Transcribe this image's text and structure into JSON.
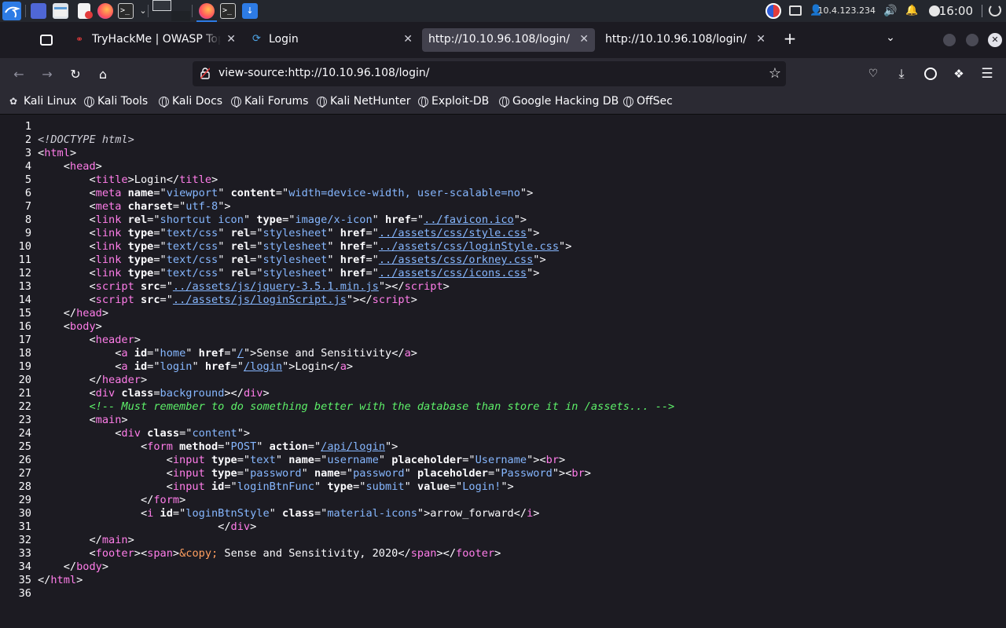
{
  "taskbar": {
    "ip": "10.4.123.234",
    "clock": "16:00"
  },
  "tabs": [
    {
      "label": "TryHackMe | OWASP Top",
      "icon": "tryhackme-icon"
    },
    {
      "label": "Login",
      "icon": "vscode-icon"
    },
    {
      "label": "http://10.10.96.108/login/",
      "icon": ""
    },
    {
      "label": "http://10.10.96.108/login/",
      "icon": ""
    }
  ],
  "address": {
    "url": "view-source:http://10.10.96.108/login/"
  },
  "bookmarks": [
    "Kali Linux",
    "Kali Tools",
    "Kali Docs",
    "Kali Forums",
    "Kali NetHunter",
    "Exploit-DB",
    "Google Hacking DB",
    "OffSec"
  ],
  "source_lines": [
    [],
    [
      [
        "dt",
        "<!DOCTYPE html>"
      ]
    ],
    [
      [
        "tx",
        "<"
      ],
      [
        "tg",
        "html"
      ],
      [
        "tx",
        ">"
      ]
    ],
    [
      [
        "tx",
        "    <"
      ],
      [
        "tg",
        "head"
      ],
      [
        "tx",
        ">"
      ]
    ],
    [
      [
        "tx",
        "        <"
      ],
      [
        "tg",
        "title"
      ],
      [
        "tx",
        ">Login</"
      ],
      [
        "tg",
        "title"
      ],
      [
        "tx",
        ">"
      ]
    ],
    [
      [
        "tx",
        "        <"
      ],
      [
        "tg",
        "meta "
      ],
      [
        "at",
        "name"
      ],
      [
        "tx",
        "=\""
      ],
      [
        "av",
        "viewport"
      ],
      [
        "tx",
        "\" "
      ],
      [
        "at",
        "content"
      ],
      [
        "tx",
        "=\""
      ],
      [
        "av",
        "width=device-width, user-scalable=no"
      ],
      [
        "tx",
        "\">"
      ]
    ],
    [
      [
        "tx",
        "        <"
      ],
      [
        "tg",
        "meta "
      ],
      [
        "at",
        "charset"
      ],
      [
        "tx",
        "=\""
      ],
      [
        "av",
        "utf-8"
      ],
      [
        "tx",
        "\">"
      ]
    ],
    [
      [
        "tx",
        "        <"
      ],
      [
        "tg",
        "link "
      ],
      [
        "at",
        "rel"
      ],
      [
        "tx",
        "=\""
      ],
      [
        "av",
        "shortcut icon"
      ],
      [
        "tx",
        "\" "
      ],
      [
        "at",
        "type"
      ],
      [
        "tx",
        "=\""
      ],
      [
        "av",
        "image/x-icon"
      ],
      [
        "tx",
        "\" "
      ],
      [
        "at",
        "href"
      ],
      [
        "tx",
        "=\""
      ],
      [
        "lk",
        "../favicon.ico"
      ],
      [
        "tx",
        "\">"
      ]
    ],
    [
      [
        "tx",
        "        <"
      ],
      [
        "tg",
        "link "
      ],
      [
        "at",
        "type"
      ],
      [
        "tx",
        "=\""
      ],
      [
        "av",
        "text/css"
      ],
      [
        "tx",
        "\" "
      ],
      [
        "at",
        "rel"
      ],
      [
        "tx",
        "=\""
      ],
      [
        "av",
        "stylesheet"
      ],
      [
        "tx",
        "\" "
      ],
      [
        "at",
        "href"
      ],
      [
        "tx",
        "=\""
      ],
      [
        "lk",
        "../assets/css/style.css"
      ],
      [
        "tx",
        "\">"
      ]
    ],
    [
      [
        "tx",
        "        <"
      ],
      [
        "tg",
        "link "
      ],
      [
        "at",
        "type"
      ],
      [
        "tx",
        "=\""
      ],
      [
        "av",
        "text/css"
      ],
      [
        "tx",
        "\" "
      ],
      [
        "at",
        "rel"
      ],
      [
        "tx",
        "=\""
      ],
      [
        "av",
        "stylesheet"
      ],
      [
        "tx",
        "\" "
      ],
      [
        "at",
        "href"
      ],
      [
        "tx",
        "=\""
      ],
      [
        "lk",
        "../assets/css/loginStyle.css"
      ],
      [
        "tx",
        "\">"
      ]
    ],
    [
      [
        "tx",
        "        <"
      ],
      [
        "tg",
        "link "
      ],
      [
        "at",
        "type"
      ],
      [
        "tx",
        "=\""
      ],
      [
        "av",
        "text/css"
      ],
      [
        "tx",
        "\" "
      ],
      [
        "at",
        "rel"
      ],
      [
        "tx",
        "=\""
      ],
      [
        "av",
        "stylesheet"
      ],
      [
        "tx",
        "\" "
      ],
      [
        "at",
        "href"
      ],
      [
        "tx",
        "=\""
      ],
      [
        "lk",
        "../assets/css/orkney.css"
      ],
      [
        "tx",
        "\">"
      ]
    ],
    [
      [
        "tx",
        "        <"
      ],
      [
        "tg",
        "link "
      ],
      [
        "at",
        "type"
      ],
      [
        "tx",
        "=\""
      ],
      [
        "av",
        "text/css"
      ],
      [
        "tx",
        "\" "
      ],
      [
        "at",
        "rel"
      ],
      [
        "tx",
        "=\""
      ],
      [
        "av",
        "stylesheet"
      ],
      [
        "tx",
        "\" "
      ],
      [
        "at",
        "href"
      ],
      [
        "tx",
        "=\""
      ],
      [
        "lk",
        "../assets/css/icons.css"
      ],
      [
        "tx",
        "\">"
      ]
    ],
    [
      [
        "tx",
        "        <"
      ],
      [
        "tg",
        "script "
      ],
      [
        "at",
        "src"
      ],
      [
        "tx",
        "=\""
      ],
      [
        "lk",
        "../assets/js/jquery-3.5.1.min.js"
      ],
      [
        "tx",
        "\"></"
      ],
      [
        "tg",
        "script"
      ],
      [
        "tx",
        ">"
      ]
    ],
    [
      [
        "tx",
        "        <"
      ],
      [
        "tg",
        "script "
      ],
      [
        "at",
        "src"
      ],
      [
        "tx",
        "=\""
      ],
      [
        "lk",
        "../assets/js/loginScript.js"
      ],
      [
        "tx",
        "\"></"
      ],
      [
        "tg",
        "script"
      ],
      [
        "tx",
        ">"
      ]
    ],
    [
      [
        "tx",
        "    </"
      ],
      [
        "tg",
        "head"
      ],
      [
        "tx",
        ">"
      ]
    ],
    [
      [
        "tx",
        "    <"
      ],
      [
        "tg",
        "body"
      ],
      [
        "tx",
        ">"
      ]
    ],
    [
      [
        "tx",
        "        <"
      ],
      [
        "tg",
        "header"
      ],
      [
        "tx",
        ">"
      ]
    ],
    [
      [
        "tx",
        "            <"
      ],
      [
        "tg",
        "a "
      ],
      [
        "at",
        "id"
      ],
      [
        "tx",
        "=\""
      ],
      [
        "av",
        "home"
      ],
      [
        "tx",
        "\" "
      ],
      [
        "at",
        "href"
      ],
      [
        "tx",
        "=\""
      ],
      [
        "lk",
        "/"
      ],
      [
        "tx",
        "\">Sense and Sensitivity</"
      ],
      [
        "tg",
        "a"
      ],
      [
        "tx",
        ">"
      ]
    ],
    [
      [
        "tx",
        "            <"
      ],
      [
        "tg",
        "a "
      ],
      [
        "at",
        "id"
      ],
      [
        "tx",
        "=\""
      ],
      [
        "av",
        "login"
      ],
      [
        "tx",
        "\" "
      ],
      [
        "at",
        "href"
      ],
      [
        "tx",
        "=\""
      ],
      [
        "lk",
        "/login"
      ],
      [
        "tx",
        "\">Login</"
      ],
      [
        "tg",
        "a"
      ],
      [
        "tx",
        ">"
      ]
    ],
    [
      [
        "tx",
        "        </"
      ],
      [
        "tg",
        "header"
      ],
      [
        "tx",
        ">"
      ]
    ],
    [
      [
        "tx",
        "        <"
      ],
      [
        "tg",
        "div "
      ],
      [
        "at",
        "class"
      ],
      [
        "tx",
        "="
      ],
      [
        "av",
        "background"
      ],
      [
        "tx",
        "></"
      ],
      [
        "tg",
        "div"
      ],
      [
        "tx",
        ">"
      ]
    ],
    [
      [
        "tx",
        "        "
      ],
      [
        "cm",
        "<!-- Must remember to do something better with the database than store it in /assets... -->"
      ]
    ],
    [
      [
        "tx",
        "        <"
      ],
      [
        "tg",
        "main"
      ],
      [
        "tx",
        ">"
      ]
    ],
    [
      [
        "tx",
        "            <"
      ],
      [
        "tg",
        "div "
      ],
      [
        "at",
        "class"
      ],
      [
        "tx",
        "=\""
      ],
      [
        "av",
        "content"
      ],
      [
        "tx",
        "\">"
      ]
    ],
    [
      [
        "tx",
        "                <"
      ],
      [
        "tg",
        "form "
      ],
      [
        "at",
        "method"
      ],
      [
        "tx",
        "=\""
      ],
      [
        "av",
        "POST"
      ],
      [
        "tx",
        "\" "
      ],
      [
        "at",
        "action"
      ],
      [
        "tx",
        "=\""
      ],
      [
        "lk",
        "/api/login"
      ],
      [
        "tx",
        "\">"
      ]
    ],
    [
      [
        "tx",
        "                    <"
      ],
      [
        "tg",
        "input "
      ],
      [
        "at",
        "type"
      ],
      [
        "tx",
        "=\""
      ],
      [
        "av",
        "text"
      ],
      [
        "tx",
        "\" "
      ],
      [
        "at",
        "name"
      ],
      [
        "tx",
        "=\""
      ],
      [
        "av",
        "username"
      ],
      [
        "tx",
        "\" "
      ],
      [
        "at",
        "placeholder"
      ],
      [
        "tx",
        "=\""
      ],
      [
        "av",
        "Username"
      ],
      [
        "tx",
        "\"><"
      ],
      [
        "tg",
        "br"
      ],
      [
        "tx",
        ">"
      ]
    ],
    [
      [
        "tx",
        "                    <"
      ],
      [
        "tg",
        "input "
      ],
      [
        "at",
        "type"
      ],
      [
        "tx",
        "=\""
      ],
      [
        "av",
        "password"
      ],
      [
        "tx",
        "\" "
      ],
      [
        "at",
        "name"
      ],
      [
        "tx",
        "=\""
      ],
      [
        "av",
        "password"
      ],
      [
        "tx",
        "\" "
      ],
      [
        "at",
        "placeholder"
      ],
      [
        "tx",
        "=\""
      ],
      [
        "av",
        "Password"
      ],
      [
        "tx",
        "\"><"
      ],
      [
        "tg",
        "br"
      ],
      [
        "tx",
        ">"
      ]
    ],
    [
      [
        "tx",
        "                    <"
      ],
      [
        "tg",
        "input "
      ],
      [
        "at",
        "id"
      ],
      [
        "tx",
        "=\""
      ],
      [
        "av",
        "loginBtnFunc"
      ],
      [
        "tx",
        "\" "
      ],
      [
        "at",
        "type"
      ],
      [
        "tx",
        "=\""
      ],
      [
        "av",
        "submit"
      ],
      [
        "tx",
        "\" "
      ],
      [
        "at",
        "value"
      ],
      [
        "tx",
        "=\""
      ],
      [
        "av",
        "Login!"
      ],
      [
        "tx",
        "\">"
      ]
    ],
    [
      [
        "tx",
        "                </"
      ],
      [
        "tg",
        "form"
      ],
      [
        "tx",
        ">"
      ]
    ],
    [
      [
        "tx",
        "                <"
      ],
      [
        "tg",
        "i "
      ],
      [
        "at",
        "id"
      ],
      [
        "tx",
        "=\""
      ],
      [
        "av",
        "loginBtnStyle"
      ],
      [
        "tx",
        "\" "
      ],
      [
        "at",
        "class"
      ],
      [
        "tx",
        "=\""
      ],
      [
        "av",
        "material-icons"
      ],
      [
        "tx",
        "\">arrow_forward</"
      ],
      [
        "tg",
        "i"
      ],
      [
        "tx",
        ">"
      ]
    ],
    [
      [
        "tx",
        "                            </"
      ],
      [
        "tg",
        "div"
      ],
      [
        "tx",
        ">"
      ]
    ],
    [
      [
        "tx",
        "        </"
      ],
      [
        "tg",
        "main"
      ],
      [
        "tx",
        ">"
      ]
    ],
    [
      [
        "tx",
        "        <"
      ],
      [
        "tg",
        "footer"
      ],
      [
        "tx",
        "><"
      ],
      [
        "tg",
        "span"
      ],
      [
        "tx",
        ">"
      ],
      [
        "en",
        "&copy;"
      ],
      [
        "tx",
        " Sense and Sensitivity, 2020</"
      ],
      [
        "tg",
        "span"
      ],
      [
        "tx",
        "></"
      ],
      [
        "tg",
        "footer"
      ],
      [
        "tx",
        ">"
      ]
    ],
    [
      [
        "tx",
        "    </"
      ],
      [
        "tg",
        "body"
      ],
      [
        "tx",
        ">"
      ]
    ],
    [
      [
        "tx",
        "</"
      ],
      [
        "tg",
        "html"
      ],
      [
        "tx",
        ">"
      ]
    ],
    []
  ]
}
